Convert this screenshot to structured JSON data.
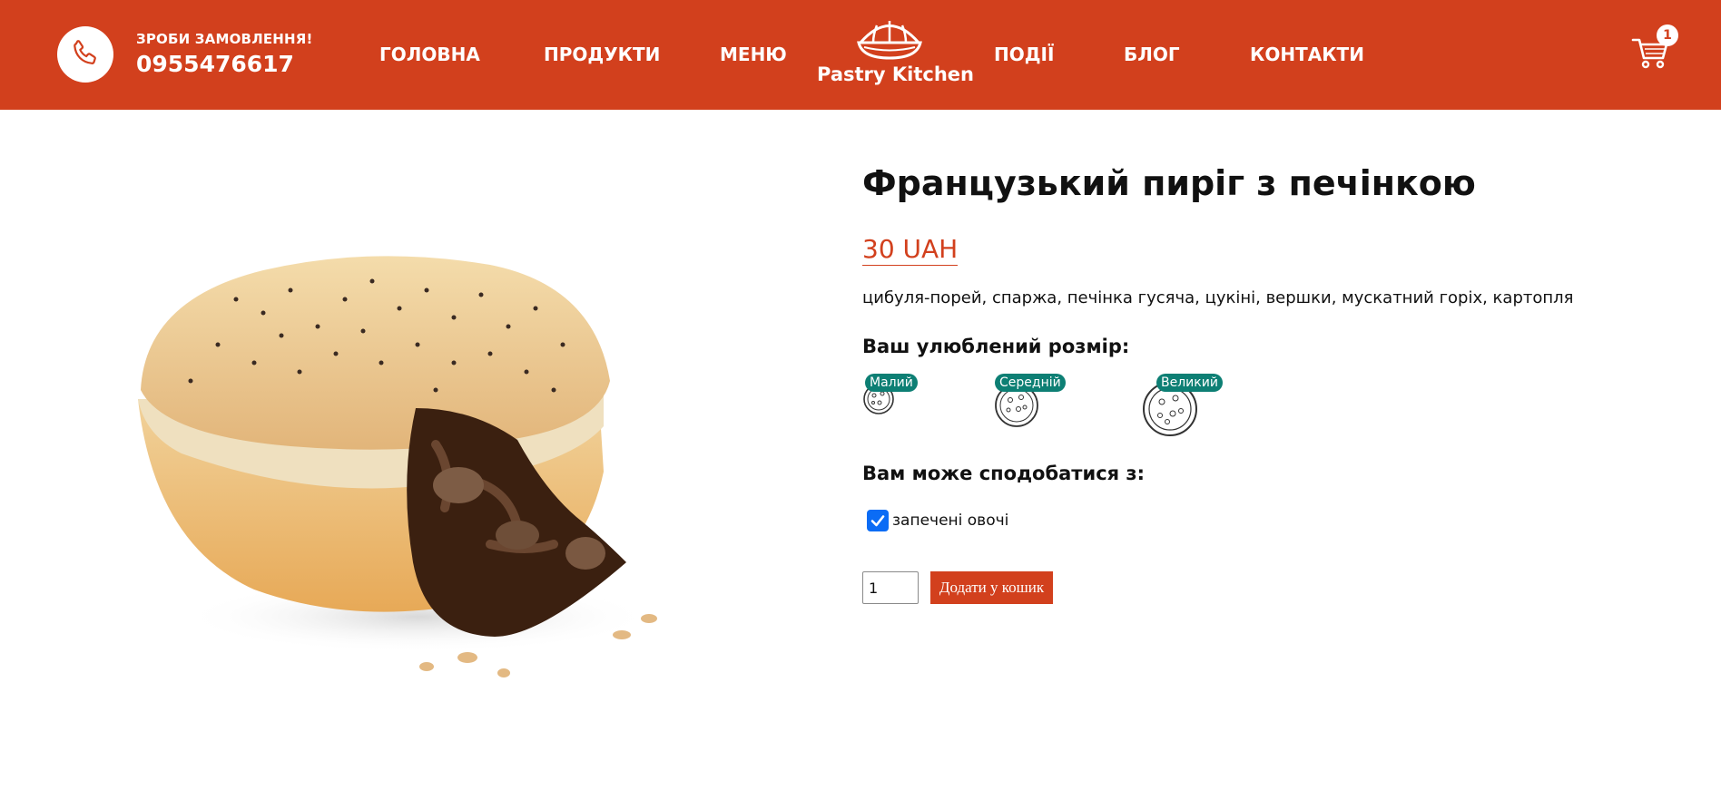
{
  "header": {
    "phone_label": "ЗРОБИ ЗАМОВЛЕННЯ!",
    "phone_number": "0955476617",
    "nav": {
      "home": "ГОЛОВНА",
      "products": "ПРОДУКТИ",
      "menu": "МЕНЮ",
      "events": "ПОДІЇ",
      "blog": "БЛОГ",
      "contacts": "КОНТАКТИ"
    },
    "logo_text": "Pastry Kitchen",
    "cart_count": "1",
    "bg_color": "#d2401d"
  },
  "product": {
    "title": "Французький пиріг з печінкою",
    "price": "30 UAH",
    "ingredients": "цибуля-порей, спаржа, печінка гусяча, цукіні, вершки, мускатний горіх, картопля",
    "size_heading": "Ваш улюблений розмір:",
    "sizes": [
      {
        "label": "Малий",
        "icon": "small-pizza-icon"
      },
      {
        "label": "Середній",
        "icon": "medium-pizza-icon"
      },
      {
        "label": "Великий",
        "icon": "large-pizza-icon"
      }
    ],
    "addon_heading": "Вам може сподобатися з:",
    "addon": {
      "label": "запечені овочі",
      "checked": true
    },
    "quantity": "1",
    "add_button": "Додати у кошик"
  },
  "colors": {
    "accent": "#d2401d",
    "badge": "#0d7f74",
    "checkbox": "#0b6cf5"
  }
}
